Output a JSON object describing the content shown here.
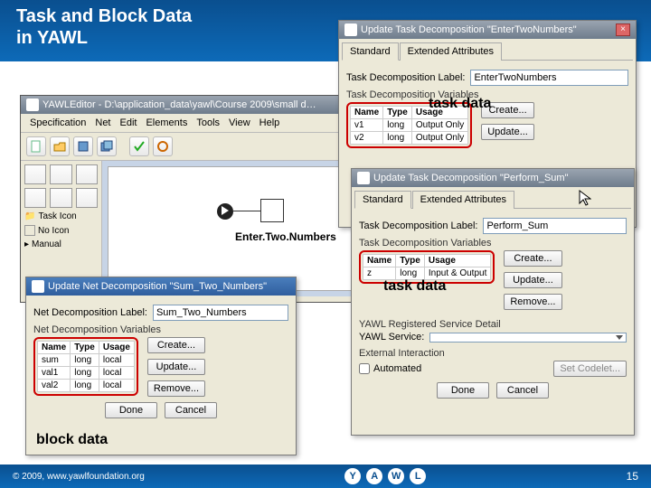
{
  "slide": {
    "title_l1": "Task and Block Data",
    "title_l2": "in YAWL",
    "footer_copy": "© 2009, www.yawlfoundation.org",
    "slide_number": "15"
  },
  "editor": {
    "title": "YAWLEditor - D:\\application_data\\yawl\\Course 2009\\small d…",
    "menu": [
      "Specification",
      "Net",
      "Edit",
      "Elements",
      "Tools",
      "View",
      "Help"
    ],
    "palette_task_icon": "Task Icon",
    "palette_no_icon": "No Icon",
    "palette_manual": "Manual",
    "task_label": "Enter.Two.Numbers"
  },
  "dlg_enter": {
    "title": "Update Task Decomposition \"EnterTwoNumbers\"",
    "tab_std": "Standard",
    "tab_ext": "Extended Attributes",
    "lbl_decomp": "Task Decomposition Label:",
    "decomp_val": "EnterTwoNumbers",
    "lbl_vars": "Task Decomposition Variables",
    "cols": [
      "Name",
      "Type",
      "Usage"
    ],
    "rows": [
      [
        "v1",
        "long",
        "Output Only"
      ],
      [
        "v2",
        "long",
        "Output Only"
      ]
    ],
    "btn_create": "Create...",
    "btn_update": "Update...",
    "annotation": "task data"
  },
  "dlg_perform": {
    "title": "Update Task Decomposition \"Perform_Sum\"",
    "tab_std": "Standard",
    "tab_ext": "Extended Attributes",
    "lbl_decomp": "Task Decomposition Label:",
    "decomp_val": "Perform_Sum",
    "lbl_vars": "Task Decomposition Variables",
    "cols": [
      "Name",
      "Type",
      "Usage"
    ],
    "rows": [
      [
        "z",
        "long",
        "Input & Output"
      ]
    ],
    "btn_create": "Create...",
    "btn_update": "Update...",
    "btn_remove": "Remove...",
    "annotation": "task data",
    "lbl_svc_grp": "YAWL Registered Service Detail",
    "lbl_svc": "YAWL Service:",
    "svc_val": "",
    "lbl_ext": "External Interaction",
    "chk_auto": "Automated",
    "btn_codelet": "Set Codelet...",
    "btn_done": "Done",
    "btn_cancel": "Cancel"
  },
  "dlg_net": {
    "title": "Update Net Decomposition \"Sum_Two_Numbers\"",
    "lbl_decomp": "Net Decomposition Label:",
    "decomp_val": "Sum_Two_Numbers",
    "lbl_vars": "Net Decomposition Variables",
    "cols": [
      "Name",
      "Type",
      "Usage"
    ],
    "rows": [
      [
        "sum",
        "long",
        "local"
      ],
      [
        "val1",
        "long",
        "local"
      ],
      [
        "val2",
        "long",
        "local"
      ]
    ],
    "btn_create": "Create...",
    "btn_update": "Update...",
    "btn_remove": "Remove...",
    "btn_done": "Done",
    "btn_cancel": "Cancel",
    "annotation": "block data"
  }
}
